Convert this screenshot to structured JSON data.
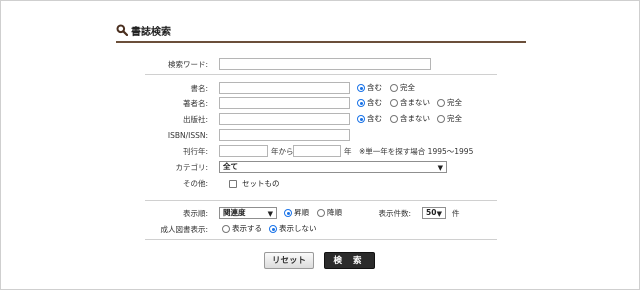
{
  "header": {
    "title": "書誌検索"
  },
  "keyword": {
    "label": "検索ワード:"
  },
  "title_row": {
    "label": "書名:",
    "options": [
      "含む",
      "完全"
    ],
    "selected": 0
  },
  "author_row": {
    "label": "著者名:",
    "options": [
      "含む",
      "含まない",
      "完全"
    ],
    "selected": 0
  },
  "publisher_row": {
    "label": "出版社:",
    "options": [
      "含む",
      "含まない",
      "完全"
    ],
    "selected": 0
  },
  "isbn": {
    "label": "ISBN/ISSN:"
  },
  "pubyear": {
    "label": "刊行年:",
    "from_suffix": "年から",
    "to_suffix": "年",
    "note": "※単一年を探す場合 1995〜1995"
  },
  "category": {
    "label": "カテゴリ:",
    "value": "全て"
  },
  "other": {
    "label": "その他:",
    "set_label": "セットもの"
  },
  "sort": {
    "label": "表示順:",
    "value": "関連度",
    "options": [
      "昇順",
      "降順"
    ],
    "selected": 0
  },
  "count": {
    "label": "表示件数:",
    "value": "50",
    "unit": "件"
  },
  "adult": {
    "label": "成人図書表示:",
    "options": [
      "表示する",
      "表示しない"
    ],
    "selected": 1
  },
  "buttons": {
    "reset": "リセット",
    "search": "検 索"
  },
  "icons": {
    "header": "search-icon"
  }
}
